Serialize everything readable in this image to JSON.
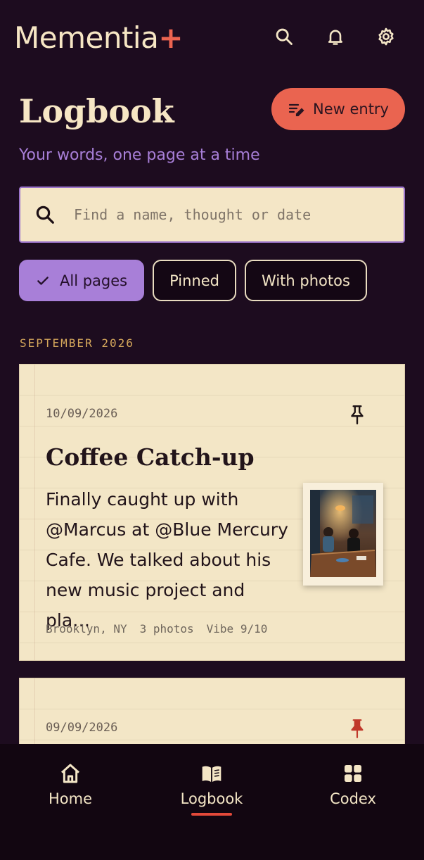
{
  "app": {
    "brand": "Mementia",
    "brand_mark": "+"
  },
  "header": {
    "icons": [
      "search-icon",
      "bell-icon",
      "gear-icon"
    ],
    "title": "Logbook",
    "new_entry_label": "New entry",
    "tagline": "Your words, one page at a time"
  },
  "search": {
    "placeholder": "Find a name, thought or date",
    "value": ""
  },
  "filters": [
    {
      "label": "All pages",
      "active": true
    },
    {
      "label": "Pinned",
      "active": false
    },
    {
      "label": "With photos",
      "active": false
    }
  ],
  "section": {
    "label": "SEPTEMBER 2026"
  },
  "entries": [
    {
      "date": "10/09/2026",
      "pinned": false,
      "title": "Coffee Catch-up",
      "body": "Finally caught up with @Marcus at @Blue Mercury Cafe. We talked about his new music project and pla…",
      "location": "Brooklyn, NY",
      "photos": "3 photos",
      "vibe": "Vibe 9/10"
    },
    {
      "date": "09/09/2026",
      "pinned": true
    }
  ],
  "nav": {
    "items": [
      {
        "label": "Home",
        "icon": "home-icon"
      },
      {
        "label": "Logbook",
        "icon": "book-icon",
        "active": true
      },
      {
        "label": "Codex",
        "icon": "grid-icon"
      }
    ]
  },
  "colors": {
    "background": "#1d0c1f",
    "accent": "#ea6450",
    "purple": "#a87fd8",
    "paper": "#f3e6c6",
    "section_gold": "#d6a85c"
  }
}
